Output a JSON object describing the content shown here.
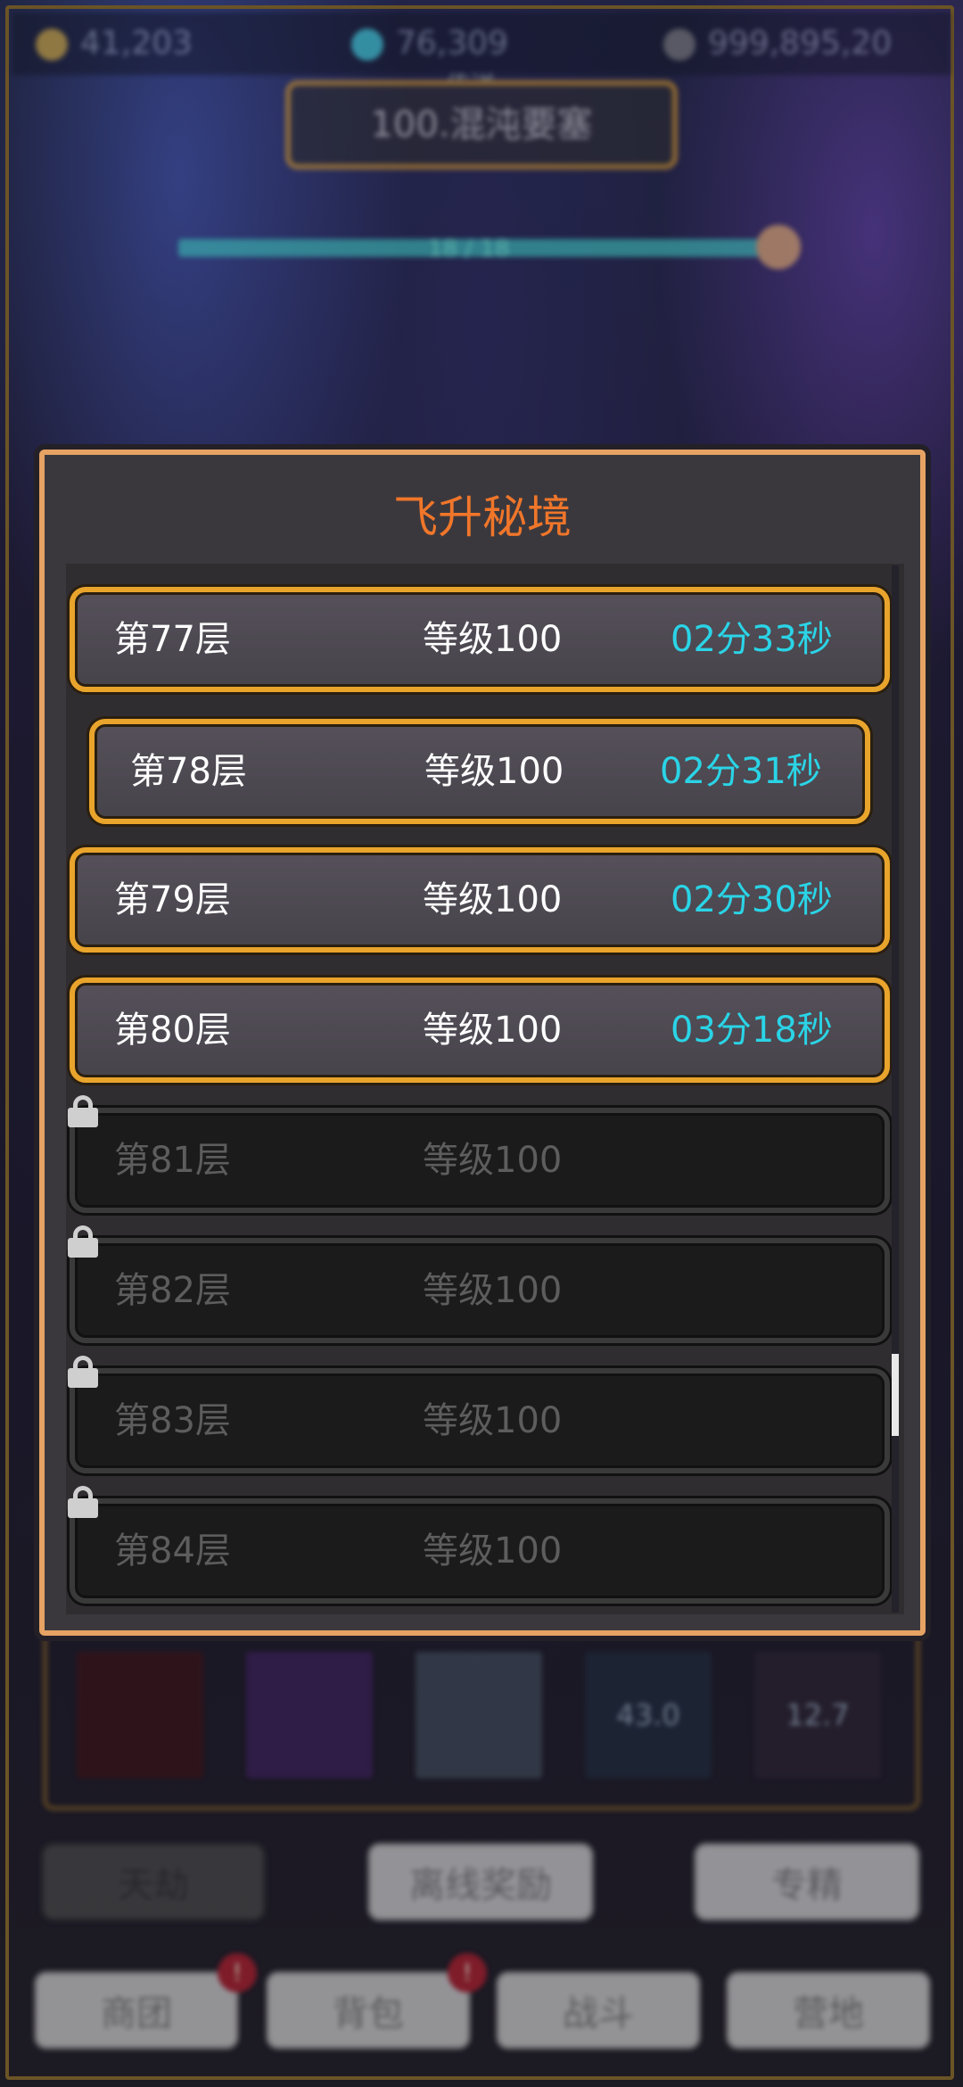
{
  "background": {
    "resources": [
      {
        "icon": "gold-coin-icon",
        "value": "41,203"
      },
      {
        "icon": "gem-icon",
        "value": "76,309"
      },
      {
        "icon": "feather-icon",
        "value": "999,895,20"
      }
    ],
    "location_subtitle": "传送",
    "location_title": "100.混沌要塞",
    "progress_text": "18 / 18",
    "skills": [
      {
        "icon": "crossed-swords-skill-icon",
        "text": ""
      },
      {
        "icon": "shadow-skill-icon",
        "text": ""
      },
      {
        "icon": "whirlwind-skill-icon",
        "text": ""
      },
      {
        "icon": "cooldown-skill-icon",
        "text": "43.0"
      },
      {
        "icon": "rage-skill-icon",
        "text": "12.7"
      }
    ],
    "buttons": {
      "tianjie": "天劫",
      "offline_reward": "离线奖励",
      "specialize": "专精",
      "guild": "商团",
      "bag": "背包",
      "battle": "战斗",
      "camp": "营地"
    },
    "badge": "!"
  },
  "modal": {
    "title": "飞升秘境",
    "floors": [
      {
        "floor": "第77层",
        "level": "等级100",
        "time": "02分33秒",
        "locked": false
      },
      {
        "floor": "第78层",
        "level": "等级100",
        "time": "02分31秒",
        "locked": false
      },
      {
        "floor": "第79层",
        "level": "等级100",
        "time": "02分30秒",
        "locked": false
      },
      {
        "floor": "第80层",
        "level": "等级100",
        "time": "03分18秒",
        "locked": false
      },
      {
        "floor": "第81层",
        "level": "等级100",
        "time": "",
        "locked": true
      },
      {
        "floor": "第82层",
        "level": "等级100",
        "time": "",
        "locked": true
      },
      {
        "floor": "第83层",
        "level": "等级100",
        "time": "",
        "locked": true
      },
      {
        "floor": "第84层",
        "level": "等级100",
        "time": "",
        "locked": true
      }
    ]
  },
  "colors": {
    "title_orange": "#f0762a",
    "time_cyan": "#2ad4e6",
    "gold_border": "#e9a42c",
    "modal_border": "#e6a363"
  }
}
